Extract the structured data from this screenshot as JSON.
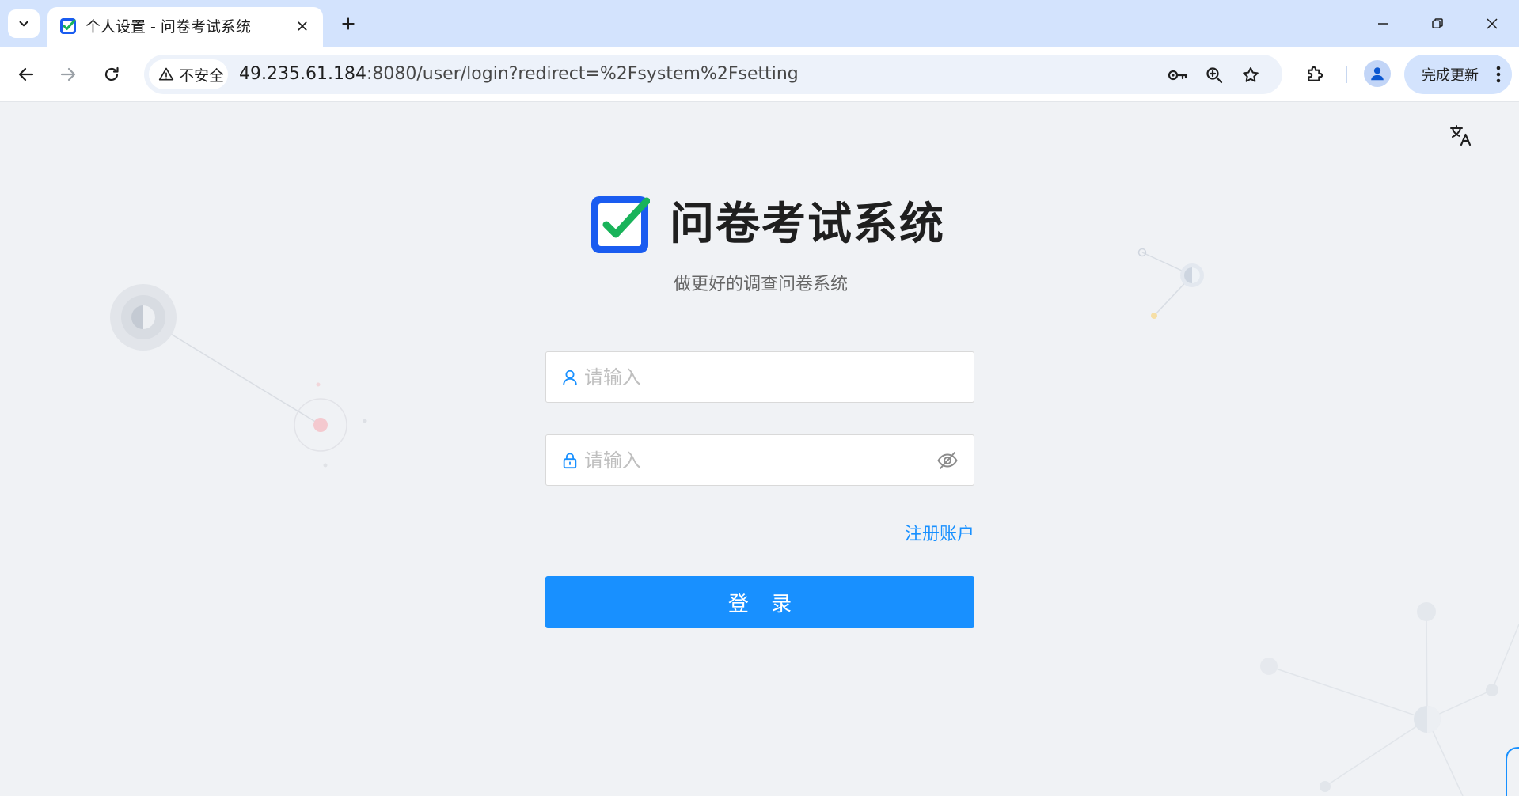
{
  "browser": {
    "tab_title": "个人设置 - 问卷考试系统",
    "security_label": "不安全",
    "url_host": "49.235.61.184",
    "url_path": ":8080/user/login?redirect=%2Fsystem%2Fsetting",
    "update_label": "完成更新"
  },
  "page": {
    "app_title": "问卷考试系统",
    "app_subtitle": "做更好的调查问卷系统",
    "username_placeholder": "请输入",
    "password_placeholder": "请输入",
    "register_link": "注册账户",
    "login_button": "登 录"
  },
  "colors": {
    "primary": "#1890ff",
    "logo_blue": "#1a5cf0",
    "logo_green": "#19b35a",
    "tabstrip": "#d3e3fd"
  },
  "icons": {
    "tab_menu": "chevron-down-icon",
    "favicon": "checkbox-logo-icon",
    "back": "arrow-left-icon",
    "forward": "arrow-right-icon",
    "reload": "reload-icon",
    "security": "warning-triangle-icon",
    "password_manager": "key-icon",
    "zoom": "zoom-in-icon",
    "bookmark": "star-icon",
    "extensions": "puzzle-icon",
    "profile": "person-icon",
    "translate": "translate-icon",
    "username": "user-icon",
    "password": "lock-icon",
    "visibility": "eye-invisible-icon"
  }
}
